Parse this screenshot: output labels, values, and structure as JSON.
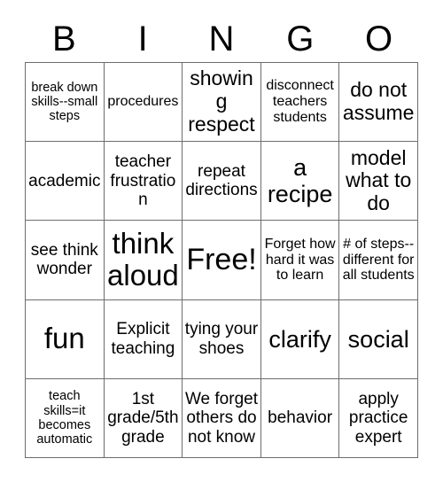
{
  "card": {
    "title": "BINGO",
    "header_letters": [
      "B",
      "I",
      "N",
      "G",
      "O"
    ],
    "free_space_label": "Free!",
    "grid_size": 5,
    "colors": {
      "background": "#ffffff",
      "text": "#000000",
      "border": "#6d6d6d"
    },
    "rows": [
      [
        {
          "text": "break down skills--small steps",
          "size": "xs"
        },
        {
          "text": "procedures",
          "size": "s"
        },
        {
          "text": "showing respect",
          "size": "l"
        },
        {
          "text": "disconnect teachers students",
          "size": "s"
        },
        {
          "text": "do not assume",
          "size": "l"
        }
      ],
      [
        {
          "text": "academic",
          "size": "m"
        },
        {
          "text": "teacher frustration",
          "size": "m"
        },
        {
          "text": "repeat directions",
          "size": "m"
        },
        {
          "text": "a recipe",
          "size": "xl"
        },
        {
          "text": "model what to do",
          "size": "l"
        }
      ],
      [
        {
          "text": "see think wonder",
          "size": "m"
        },
        {
          "text": "think aloud",
          "size": "xxl"
        },
        {
          "text": "Free!",
          "size": "free"
        },
        {
          "text": "Forget how hard it was to learn",
          "size": "s"
        },
        {
          "text": "# of steps--different for all students",
          "size": "s"
        }
      ],
      [
        {
          "text": "fun",
          "size": "xxl"
        },
        {
          "text": "Explicit teaching",
          "size": "m"
        },
        {
          "text": "tying your shoes",
          "size": "m"
        },
        {
          "text": "clarify",
          "size": "xl"
        },
        {
          "text": "social",
          "size": "xl"
        }
      ],
      [
        {
          "text": "teach skills=it becomes automatic",
          "size": "xs"
        },
        {
          "text": "1st grade/5th grade",
          "size": "m"
        },
        {
          "text": "We forget others do not know",
          "size": "m"
        },
        {
          "text": "behavior",
          "size": "m"
        },
        {
          "text": "apply practice expert",
          "size": "m"
        }
      ]
    ]
  }
}
